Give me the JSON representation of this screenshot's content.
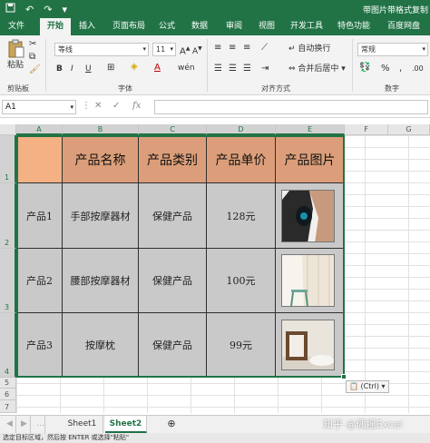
{
  "app": {
    "window_title": "带图片带格式复制",
    "qat_icons": [
      "save-icon",
      "undo-icon",
      "redo-icon",
      "customize-icon"
    ]
  },
  "ribbon_tabs": [
    "文件",
    "开始",
    "插入",
    "页面布局",
    "公式",
    "数据",
    "审阅",
    "视图",
    "开发工具",
    "特色功能",
    "百度网盘"
  ],
  "active_tab": "开始",
  "ribbon": {
    "clipboard": {
      "paste_label": "粘贴",
      "group_label": "剪贴板"
    },
    "font": {
      "font_name": "等线",
      "font_size": "11",
      "group_label": "字体",
      "bold": "B",
      "italic": "I",
      "underline": "U"
    },
    "alignment": {
      "wrap_text": "自动换行",
      "merge_center": "合并后居中",
      "group_label": "对齐方式"
    },
    "number": {
      "format": "常规",
      "group_label": "数字",
      "percent": "%"
    }
  },
  "formula_bar": {
    "name_box": "A1",
    "fx_label": "fx",
    "value": ""
  },
  "columns": [
    "A",
    "B",
    "C",
    "D",
    "E",
    "F",
    "G"
  ],
  "rows": [
    "1",
    "2",
    "3",
    "4",
    "5",
    "6",
    "7"
  ],
  "table": {
    "headers": [
      "",
      "产品名称",
      "产品类别",
      "产品单价",
      "产品图片"
    ],
    "rows": [
      {
        "a": "产品1",
        "name": "手部按摩器材",
        "category": "保健产品",
        "price": "128元"
      },
      {
        "a": "产品2",
        "name": "腰部按摩器材",
        "category": "保健产品",
        "price": "100元"
      },
      {
        "a": "产品3",
        "name": "按摩枕",
        "category": "保健产品",
        "price": "99元"
      }
    ]
  },
  "paste_options": {
    "label": "(Ctrl)"
  },
  "sheets": [
    "Sheet1",
    "Sheet2"
  ],
  "active_sheet": "Sheet2",
  "status_text": "选定目标区域，然后按 ENTER 或选择\"粘贴\"",
  "watermark": "知乎 @偶摇Excel",
  "colors": {
    "excel_green": "#217346",
    "header_fill": "#f4b183",
    "body_fill": "#c9c9c9"
  }
}
